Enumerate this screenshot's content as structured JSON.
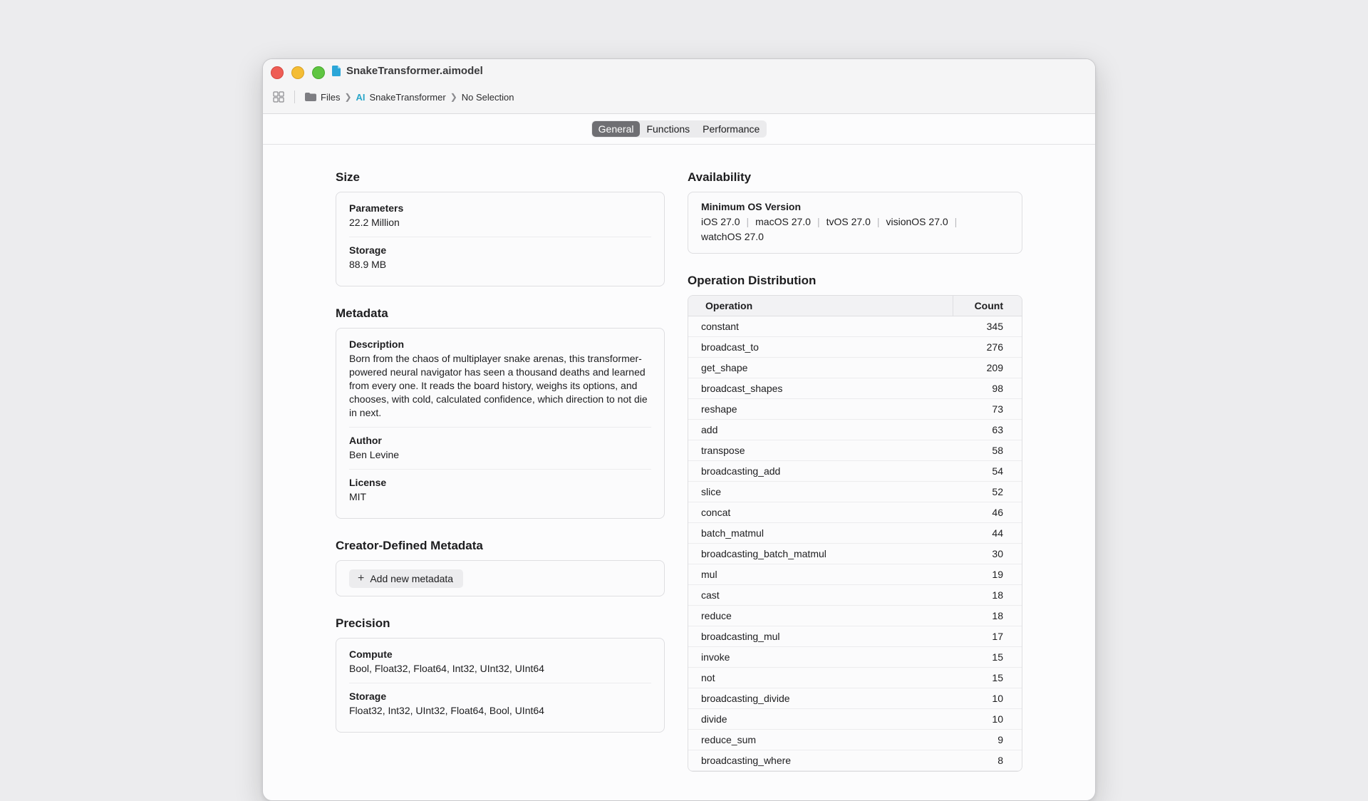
{
  "window": {
    "title": "SnakeTransformer.aimodel",
    "breadcrumb": [
      "Files",
      "SnakeTransformer",
      "No Selection"
    ],
    "tabs": [
      "General",
      "Functions",
      "Performance"
    ],
    "active_tab": "General"
  },
  "size": {
    "title": "Size",
    "parameters_label": "Parameters",
    "parameters_value": "22.2 Million",
    "storage_label": "Storage",
    "storage_value": "88.9 MB"
  },
  "metadata": {
    "title": "Metadata",
    "description_label": "Description",
    "description_value": "Born from the chaos of multiplayer snake arenas, this transformer-powered neural navigator has seen a thousand deaths and learned from every one. It reads the board history, weighs its options, and chooses, with cold, calculated confidence, which direction to not die in next.",
    "author_label": "Author",
    "author_value": "Ben Levine",
    "license_label": "License",
    "license_value": "MIT"
  },
  "creator_metadata": {
    "title": "Creator-Defined Metadata",
    "add_label": "Add new metadata"
  },
  "precision": {
    "title": "Precision",
    "compute_label": "Compute",
    "compute_value": "Bool, Float32, Float64, Int32, UInt32, UInt64",
    "storage_label": "Storage",
    "storage_value": "Float32, Int32, UInt32, Float64, Bool, UInt64"
  },
  "availability": {
    "title": "Availability",
    "min_os_label": "Minimum OS Version",
    "os_versions": [
      "iOS 27.0",
      "macOS 27.0",
      "tvOS 27.0",
      "visionOS 27.0",
      "watchOS 27.0"
    ]
  },
  "operations": {
    "title": "Operation Distribution",
    "headers": [
      "Operation",
      "Count"
    ],
    "rows": [
      {
        "op": "constant",
        "count": "345"
      },
      {
        "op": "broadcast_to",
        "count": "276"
      },
      {
        "op": "get_shape",
        "count": "209"
      },
      {
        "op": "broadcast_shapes",
        "count": "98"
      },
      {
        "op": "reshape",
        "count": "73"
      },
      {
        "op": "add",
        "count": "63"
      },
      {
        "op": "transpose",
        "count": "58"
      },
      {
        "op": "broadcasting_add",
        "count": "54"
      },
      {
        "op": "slice",
        "count": "52"
      },
      {
        "op": "concat",
        "count": "46"
      },
      {
        "op": "batch_matmul",
        "count": "44"
      },
      {
        "op": "broadcasting_batch_matmul",
        "count": "30"
      },
      {
        "op": "mul",
        "count": "19"
      },
      {
        "op": "cast",
        "count": "18"
      },
      {
        "op": "reduce",
        "count": "18"
      },
      {
        "op": "broadcasting_mul",
        "count": "17"
      },
      {
        "op": "invoke",
        "count": "15"
      },
      {
        "op": "not",
        "count": "15"
      },
      {
        "op": "broadcasting_divide",
        "count": "10"
      },
      {
        "op": "divide",
        "count": "10"
      },
      {
        "op": "reduce_sum",
        "count": "9"
      },
      {
        "op": "broadcasting_where",
        "count": "8"
      }
    ]
  }
}
